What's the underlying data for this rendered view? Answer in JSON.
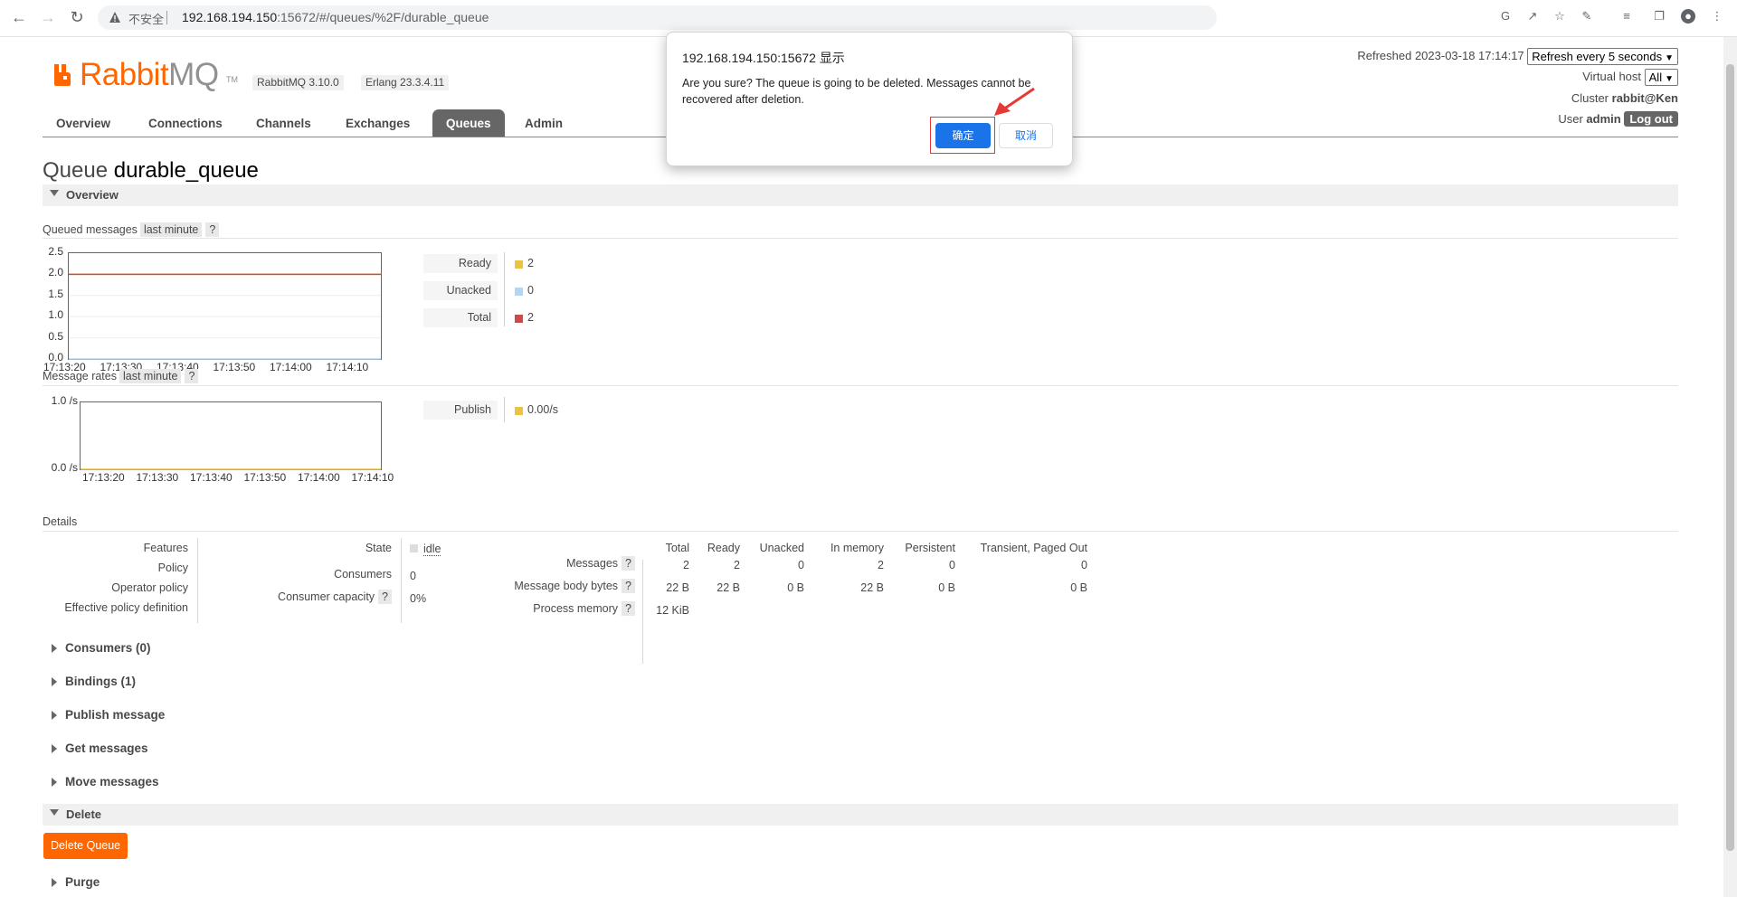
{
  "browser": {
    "insecure_label": "不安全",
    "url_host": "192.168.194.150",
    "url_rest": ":15672/#/queues/%2F/durable_queue"
  },
  "logo": {
    "rabbit": "Rabbit",
    "mq": "MQ",
    "tm": "TM"
  },
  "versions": {
    "rabbitmq": "RabbitMQ 3.10.0",
    "erlang": "Erlang 23.3.4.11"
  },
  "tabs": [
    "Overview",
    "Connections",
    "Channels",
    "Exchanges",
    "Queues",
    "Admin"
  ],
  "active_tab": "Queues",
  "status": {
    "refreshed": "Refreshed 2023-03-18 17:14:17",
    "refresh_select": "Refresh every 5 seconds",
    "vhost_label": "Virtual host",
    "vhost_value": "All",
    "cluster_label": "Cluster",
    "cluster_value": "rabbit@Ken",
    "user_label": "User",
    "user_value": "admin",
    "logout": "Log out"
  },
  "queue": {
    "prefix": "Queue",
    "name": "durable_queue"
  },
  "sections": {
    "overview": "Overview",
    "queued_messages": "Queued messages",
    "message_rates": "Message rates",
    "period": "last minute",
    "help": "?",
    "details": "Details",
    "delete": "Delete"
  },
  "colors": {
    "ready": "#edc240",
    "unacked": "#afd8f8",
    "total": "#cb4b4b",
    "publish": "#edc240",
    "accent": "#ff6600"
  },
  "legend_queued": [
    {
      "label": "Ready",
      "value": "2"
    },
    {
      "label": "Unacked",
      "value": "0"
    },
    {
      "label": "Total",
      "value": "2"
    }
  ],
  "legend_rates": [
    {
      "label": "Publish",
      "value": "0.00/s"
    }
  ],
  "chart_data": [
    {
      "type": "line",
      "ylabels": [
        "2.5",
        "2.0",
        "1.5",
        "1.0",
        "0.5",
        "0.0"
      ],
      "xlabels": [
        "17:13:20",
        "17:13:30",
        "17:13:40",
        "17:13:50",
        "17:14:00",
        "17:14:10"
      ],
      "ylim": [
        0,
        2.5
      ],
      "series": [
        {
          "name": "Ready",
          "values": [
            2,
            2,
            2,
            2,
            2,
            2
          ]
        },
        {
          "name": "Unacked",
          "values": [
            0,
            0,
            0,
            0,
            0,
            0
          ]
        },
        {
          "name": "Total",
          "values": [
            2,
            2,
            2,
            2,
            2,
            2
          ]
        }
      ]
    },
    {
      "type": "line",
      "ylabels": [
        "1.0 /s",
        "0.0 /s"
      ],
      "xlabels": [
        "17:13:20",
        "17:13:30",
        "17:13:40",
        "17:13:50",
        "17:14:00",
        "17:14:10"
      ],
      "ylim": [
        0,
        1
      ],
      "series": [
        {
          "name": "Publish",
          "values": [
            0,
            0,
            0,
            0,
            0,
            0
          ]
        }
      ]
    }
  ],
  "details": {
    "left_labels": [
      "Features",
      "Policy",
      "Operator policy",
      "Effective policy definition"
    ],
    "state_label": "State",
    "state_value": "idle",
    "consumers_label": "Consumers",
    "consumers_value": "0",
    "capacity_label": "Consumer capacity",
    "capacity_value": "0%",
    "columns": [
      "Total",
      "Ready",
      "Unacked",
      "In memory",
      "Persistent",
      "Transient, Paged Out"
    ],
    "rows": [
      {
        "label": "Messages",
        "values": [
          "2",
          "2",
          "0",
          "2",
          "0",
          "0"
        ]
      },
      {
        "label": "Message body bytes",
        "values": [
          "22 B",
          "22 B",
          "0 B",
          "22 B",
          "0 B",
          "0 B"
        ]
      },
      {
        "label": "Process memory",
        "values": [
          "12 KiB"
        ]
      }
    ]
  },
  "collapsed_sections": [
    "Consumers (0)",
    "Bindings (1)",
    "Publish message",
    "Get messages",
    "Move messages"
  ],
  "delete_button": "Delete Queue",
  "purge": "Purge",
  "dialog": {
    "title": "192.168.194.150:15672 显示",
    "message": "Are you sure? The queue is going to be deleted. Messages cannot be recovered after deletion.",
    "ok": "确定",
    "cancel": "取消"
  }
}
